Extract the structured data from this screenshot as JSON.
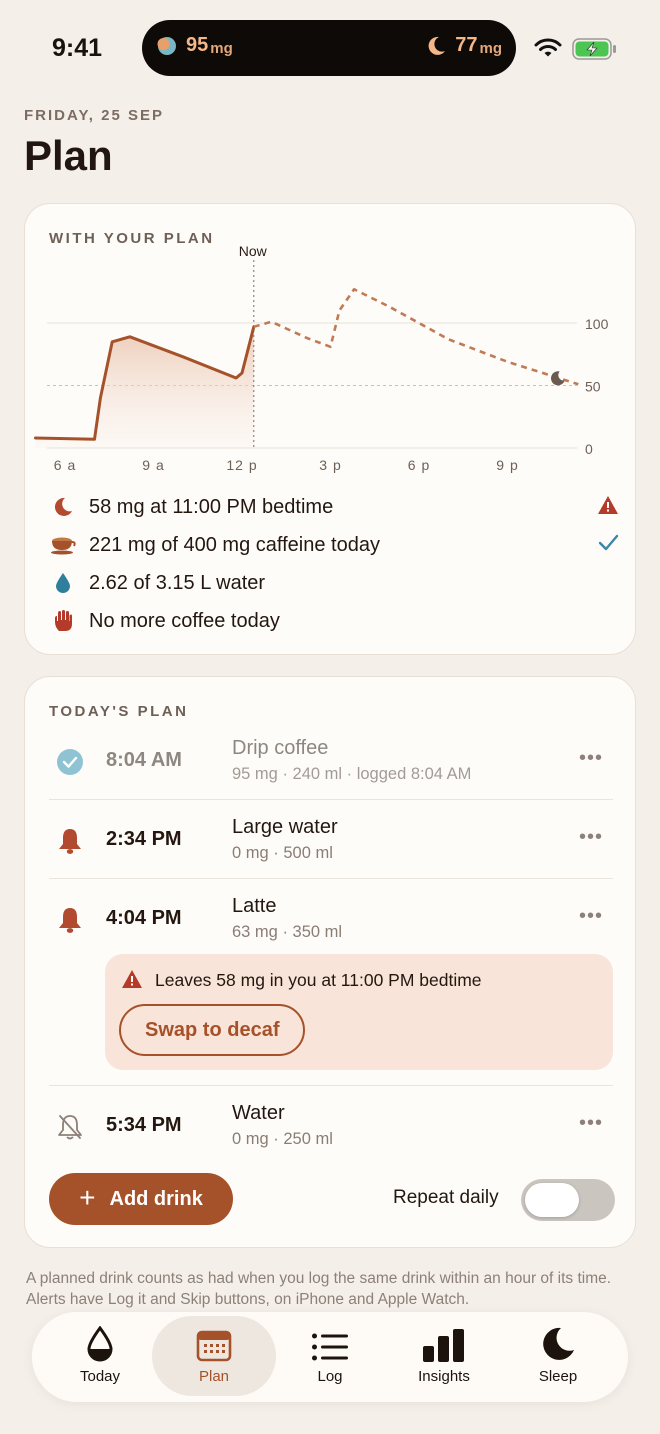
{
  "status_bar": {
    "time": "9:41",
    "island_left_value": "95",
    "island_left_unit": "mg",
    "island_right_value": "77",
    "island_right_unit": "mg"
  },
  "header": {
    "date": "FRIDAY, 25 SEP",
    "title": "Plan"
  },
  "chart_card": {
    "label": "WITH YOUR PLAN",
    "now_label": "Now",
    "chart_data": {
      "type": "line",
      "x_ticks": [
        "6 a",
        "9 a",
        "12 p",
        "3 p",
        "6 p",
        "9 p"
      ],
      "y_ticks": [
        "100",
        "50",
        "0"
      ],
      "ylim": [
        0,
        100
      ],
      "series": [
        {
          "style": "solid",
          "points": [
            [
              5.0,
              8
            ],
            [
              7.0,
              7
            ],
            [
              7.2,
              40
            ],
            [
              7.6,
              85
            ],
            [
              8.2,
              89
            ],
            [
              10.0,
              73
            ],
            [
              11.8,
              56
            ],
            [
              12.0,
              60
            ],
            [
              12.4,
              97
            ]
          ]
        },
        {
          "style": "dashed",
          "points": [
            [
              12.4,
              97
            ],
            [
              13.0,
              101
            ],
            [
              14.2,
              88
            ],
            [
              15.0,
              81
            ],
            [
              15.3,
              110
            ],
            [
              15.8,
              127
            ],
            [
              17.0,
              113
            ],
            [
              19.0,
              87
            ],
            [
              21.0,
              69
            ],
            [
              22.6,
              57
            ],
            [
              23.4,
              51
            ]
          ]
        }
      ],
      "bedtime_marker_x": 22.7
    },
    "summary": [
      {
        "icon": "moon-icon",
        "text": "58 mg at 11:00 PM bedtime",
        "status": "warning"
      },
      {
        "icon": "coffee-cup-icon",
        "text": "221 mg of 400 mg caffeine today",
        "status": "ok"
      },
      {
        "icon": "water-drop-icon",
        "text": "2.62 of 3.15 L water",
        "status": ""
      },
      {
        "icon": "stop-hand-icon",
        "text": "No more coffee today",
        "status": ""
      }
    ]
  },
  "today_card": {
    "label": "TODAY'S PLAN",
    "items": [
      {
        "time": "8:04 AM",
        "name": "Drip coffee",
        "detail": "95 mg · 240 ml · logged 8:04 AM",
        "state": "logged"
      },
      {
        "time": "2:34 PM",
        "name": "Large water",
        "detail": "0 mg · 500 ml",
        "state": "alert"
      },
      {
        "time": "4:04 PM",
        "name": "Latte",
        "detail": "63 mg · 350 ml",
        "state": "alert"
      },
      {
        "time": "5:34 PM",
        "name": "Water",
        "detail": "0 mg · 250 ml",
        "state": "muted"
      }
    ],
    "warning_text": "Leaves 58 mg in you at 11:00 PM bedtime",
    "swap_label": "Swap to decaf",
    "add_label": "Add drink",
    "repeat_label": "Repeat daily",
    "repeat_on": false
  },
  "footnote": "A planned drink counts as had when you log the same drink within an hour of its time. Alerts have Log it and Skip buttons, on iPhone and Apple Watch.",
  "tabs": [
    {
      "label": "Today",
      "icon": "drop-icon"
    },
    {
      "label": "Plan",
      "icon": "calendar-icon",
      "active": true
    },
    {
      "label": "Log",
      "icon": "list-icon"
    },
    {
      "label": "Insights",
      "icon": "bar-chart-icon"
    },
    {
      "label": "Sleep",
      "icon": "moon-icon"
    }
  ],
  "colors": {
    "accent": "#a5522a",
    "background": "#f5efe9",
    "card": "#fefcf9",
    "warning": "#b43a2a",
    "check": "#3b87a8"
  }
}
